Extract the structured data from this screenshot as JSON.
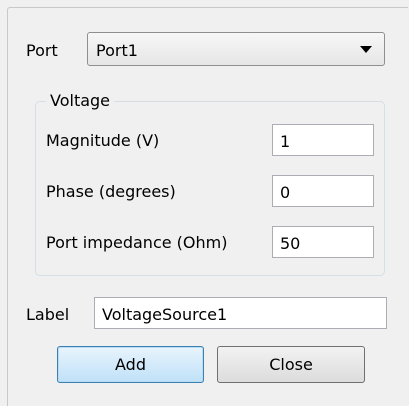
{
  "port": {
    "label": "Port",
    "selected": "Port1"
  },
  "voltage": {
    "title": "Voltage",
    "magnitude": {
      "label": "Magnitude (V)",
      "value": "1"
    },
    "phase": {
      "label": "Phase (degrees)",
      "value": "0"
    },
    "impedance": {
      "label": "Port impedance (Ohm)",
      "value": "50"
    }
  },
  "label_field": {
    "label": "Label",
    "value": "VoltageSource1"
  },
  "buttons": {
    "add": "Add",
    "close": "Close"
  }
}
